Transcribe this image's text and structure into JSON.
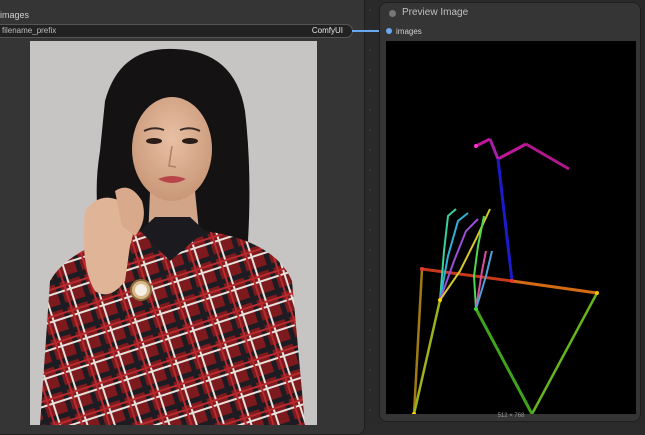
{
  "save_node": {
    "input_label": "images",
    "filename_prefix": {
      "label": "filename_prefix",
      "value": "ComfyUI"
    }
  },
  "preview_node": {
    "title": "Preview Image",
    "input_label": "images",
    "image_dimensions": "512 × 768"
  },
  "colors": {
    "node_bg": "#353535",
    "canvas_bg": "#2a2a2a",
    "link": "#6aa8ef",
    "pose_bg": "#000000"
  }
}
